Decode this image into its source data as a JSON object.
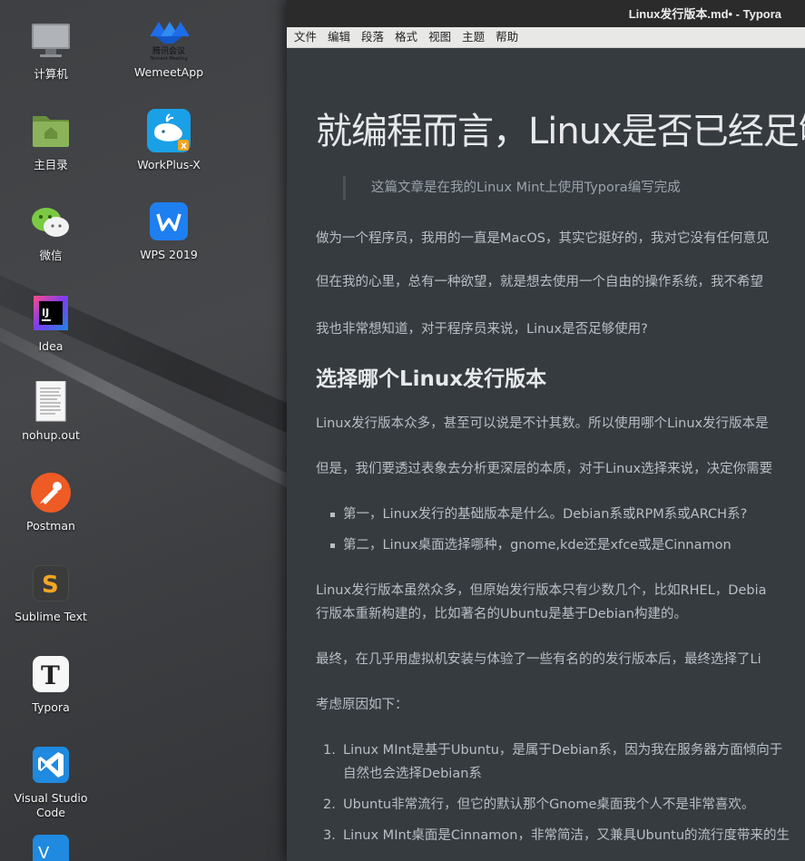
{
  "desktop": {
    "icons": [
      {
        "label": "计算机",
        "icon": "monitor-icon"
      },
      {
        "label": "WemeetApp",
        "icon": "tencent-meeting-icon",
        "sublabel": "腾讯会议",
        "subsublabel": "Tencent Meeting"
      },
      {
        "label": "主目录",
        "icon": "home-folder-icon"
      },
      {
        "label": "WorkPlus-X",
        "icon": "whale-icon"
      },
      {
        "label": "微信",
        "icon": "wechat-icon"
      },
      {
        "label": "WPS 2019",
        "icon": "wps-icon"
      },
      {
        "label": "Idea",
        "icon": "intellij-icon"
      },
      {
        "label": "nohup.out",
        "icon": "text-file-icon"
      },
      {
        "label": "Postman",
        "icon": "postman-icon"
      },
      {
        "label": "Sublime Text",
        "icon": "sublime-icon"
      },
      {
        "label": "Typora",
        "icon": "typora-icon"
      },
      {
        "label": "Visual Studio Code",
        "icon": "vscode-icon"
      }
    ]
  },
  "window": {
    "title": "Linux发行版本.md• - Typora",
    "menu": [
      "文件",
      "编辑",
      "段落",
      "格式",
      "视图",
      "主题",
      "帮助"
    ]
  },
  "doc": {
    "h1": "就编程而言，Linux是否已经足够",
    "quote": "这篇文章是在我的Linux Mint上使用Typora编写完成",
    "p1": "做为一个程序员，我用的一直是MacOS，其实它挺好的，我对它没有任何意见",
    "p2": "但在我的心里，总有一种欲望，就是想去使用一个自由的操作系统，我不希望",
    "p3": "我也非常想知道，对于程序员来说，Linux是否足够使用?",
    "h2": "选择哪个Linux发行版本",
    "p4": "Linux发行版本众多，甚至可以说是不计其数。所以使用哪个Linux发行版本是",
    "p5": "但是，我们要透过表象去分析更深层的本质，对于Linux选择来说，决定你需要",
    "bullets": [
      "第一，Linux发行的基础版本是什么。Debian系或RPM系或ARCH系?",
      "第二，Linux桌面选择哪种，gnome,kde还是xfce或是Cinnamon"
    ],
    "p6a": "Linux发行版本虽然众多，但原始发行版本只有少数几个，比如RHEL，Debia",
    "p6b": "行版本重新构建的，比如著名的Ubuntu是基于Debian构建的。",
    "p7": "最终，在几乎用虚拟机安装与体验了一些有名的的发行版本后，最终选择了Li",
    "p8": "考虑原因如下：",
    "ol": [
      {
        "num": "1.",
        "a": "Linux MInt是基于Ubuntu，是属于Debian系，因为我在服务器方面倾向于",
        "b": "自然也会选择Debian系"
      },
      {
        "num": "2.",
        "a": "Ubuntu非常流行，但它的默认那个Gnome桌面我个人不是非常喜欢。"
      },
      {
        "num": "3.",
        "a": "Linux MInt桌面是Cinnamon，非常简洁，又兼具Ubuntu的流行度带来的生"
      }
    ]
  }
}
